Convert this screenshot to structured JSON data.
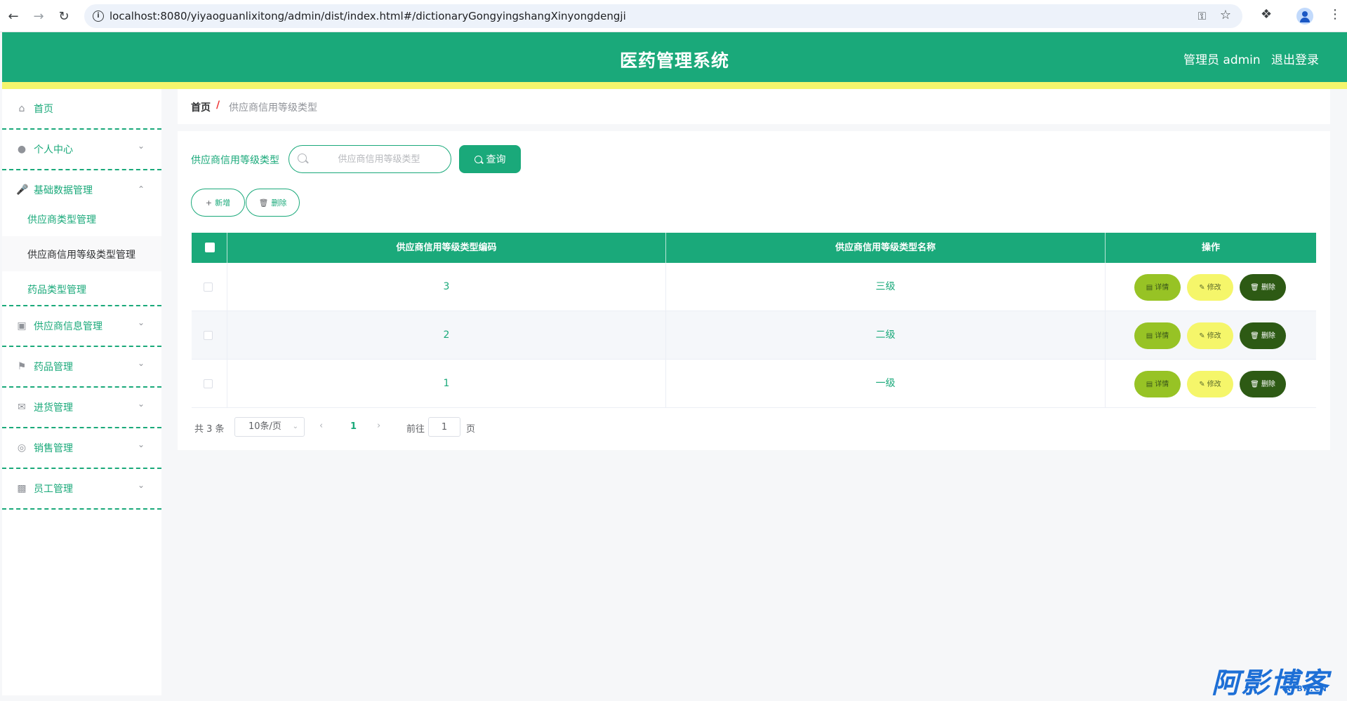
{
  "browser": {
    "url": "localhost:8080/yiyaoguanlixitong/admin/dist/index.html#/dictionaryGongyingshangXinyongdengji"
  },
  "header": {
    "title": "医药管理系统",
    "user": "管理员 admin",
    "logout": "退出登录"
  },
  "sidebar": {
    "items": [
      {
        "label": "首页",
        "icon": "home-icon"
      },
      {
        "label": "个人中心",
        "icon": "user-icon"
      },
      {
        "label": "基础数据管理",
        "icon": "microphone-icon"
      },
      {
        "label": "供应商信息管理",
        "icon": "briefcase-icon"
      },
      {
        "label": "药品管理",
        "icon": "flag-icon"
      },
      {
        "label": "进货管理",
        "icon": "mail-icon"
      },
      {
        "label": "销售管理",
        "icon": "lifebuoy-icon"
      },
      {
        "label": "员工管理",
        "icon": "toolbox-icon"
      }
    ],
    "sub": [
      {
        "label": "供应商类型管理"
      },
      {
        "label": "供应商信用等级类型管理"
      },
      {
        "label": "药品类型管理"
      }
    ]
  },
  "breadcrumb": {
    "home": "首页",
    "sep": "/",
    "current": "供应商信用等级类型"
  },
  "search": {
    "label": "供应商信用等级类型",
    "placeholder": "供应商信用等级类型",
    "button": "查询"
  },
  "actions": {
    "add": "新增",
    "delete": "删除"
  },
  "table": {
    "headers": [
      "供应商信用等级类型编码",
      "供应商信用等级类型名称",
      "操作"
    ],
    "rows": [
      {
        "code": "3",
        "name": "三级"
      },
      {
        "code": "2",
        "name": "二级"
      },
      {
        "code": "1",
        "name": "一级"
      }
    ],
    "row_actions": {
      "detail": "详情",
      "edit": "修改",
      "delete": "删除"
    }
  },
  "pagination": {
    "total": "共 3 条",
    "page_size": "10条/页",
    "current": "1",
    "goto": "前往",
    "goto_value": "1",
    "page_suffix": "页"
  },
  "watermark": {
    "text": "阿影博客",
    "sub": "AYBK.CN"
  },
  "colors": {
    "primary": "#1aa97a",
    "accent": "#f4f56c",
    "detail": "#97c325",
    "edit": "#f5f66a",
    "delete": "#2d5a14"
  }
}
